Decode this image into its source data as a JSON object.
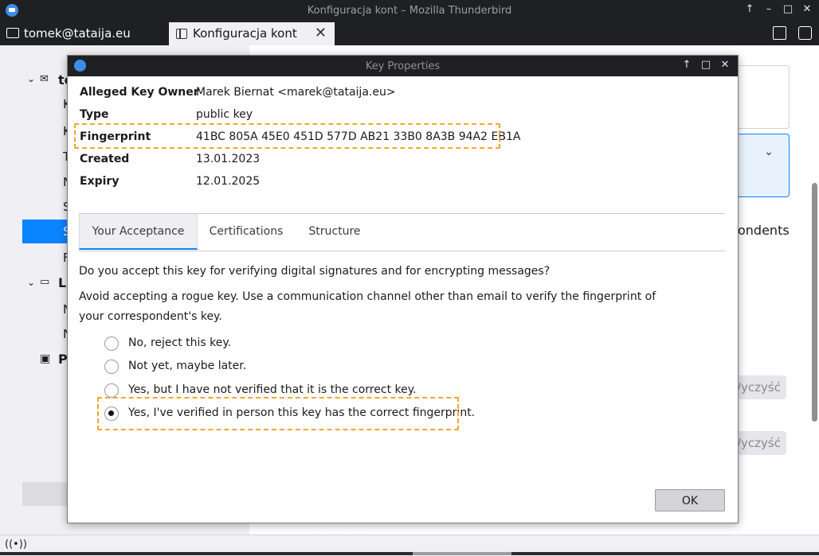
{
  "window": {
    "title": "Konfiguracja kont – Mozilla Thunderbird",
    "controls": [
      "↑",
      "–",
      "□",
      "✕"
    ]
  },
  "tabs": {
    "account_tab": "tomek@tataija.eu",
    "active_tab": "Konfiguracja kont",
    "close_glyph": "✕"
  },
  "background": {
    "sidebar_letters": [
      "to",
      "K",
      "K",
      "T",
      "N",
      "S",
      "S",
      "F",
      "Lo",
      "N",
      "N",
      "Po"
    ],
    "right_partial_text": "ondents",
    "clear_button_1": "/yczyść",
    "clear_button_2": "/yczyść",
    "bottom_partial_text": ". . . . ."
  },
  "dialog": {
    "title": "Key Properties",
    "controls": [
      "↑",
      "□",
      "✕"
    ],
    "properties": [
      {
        "key": "Alleged Key Owner",
        "value": "Marek Biernat <marek@tataija.eu>"
      },
      {
        "key": "Type",
        "value": "public key"
      },
      {
        "key": "Fingerprint",
        "value": "41BC 805A 45E0 451D 577D AB21 33B0 8A3B 94A2 EB1A"
      },
      {
        "key": "Created",
        "value": "13.01.2023"
      },
      {
        "key": "Expiry",
        "value": "12.01.2025"
      }
    ],
    "tabs": [
      "Your Acceptance",
      "Certifications",
      "Structure"
    ],
    "active_tab_index": 0,
    "question": "Do you accept this key for verifying digital signatures and for encrypting messages?",
    "warning": "Avoid accepting a rogue key. Use a communication channel other than email to verify the fingerprint of your correspondent's key.",
    "options": [
      {
        "label": "No, reject this key.",
        "selected": false
      },
      {
        "label": "Not yet, maybe later.",
        "selected": false
      },
      {
        "label": "Yes, but I have not verified that it is the correct key.",
        "selected": false
      },
      {
        "label": "Yes, I've verified in person this key has the correct fingerprint.",
        "selected": true
      }
    ],
    "ok_label": "OK"
  },
  "colors": {
    "titlebar": "#1f2023",
    "accent": "#0a84ff",
    "highlight_dash": "#f5a623"
  }
}
